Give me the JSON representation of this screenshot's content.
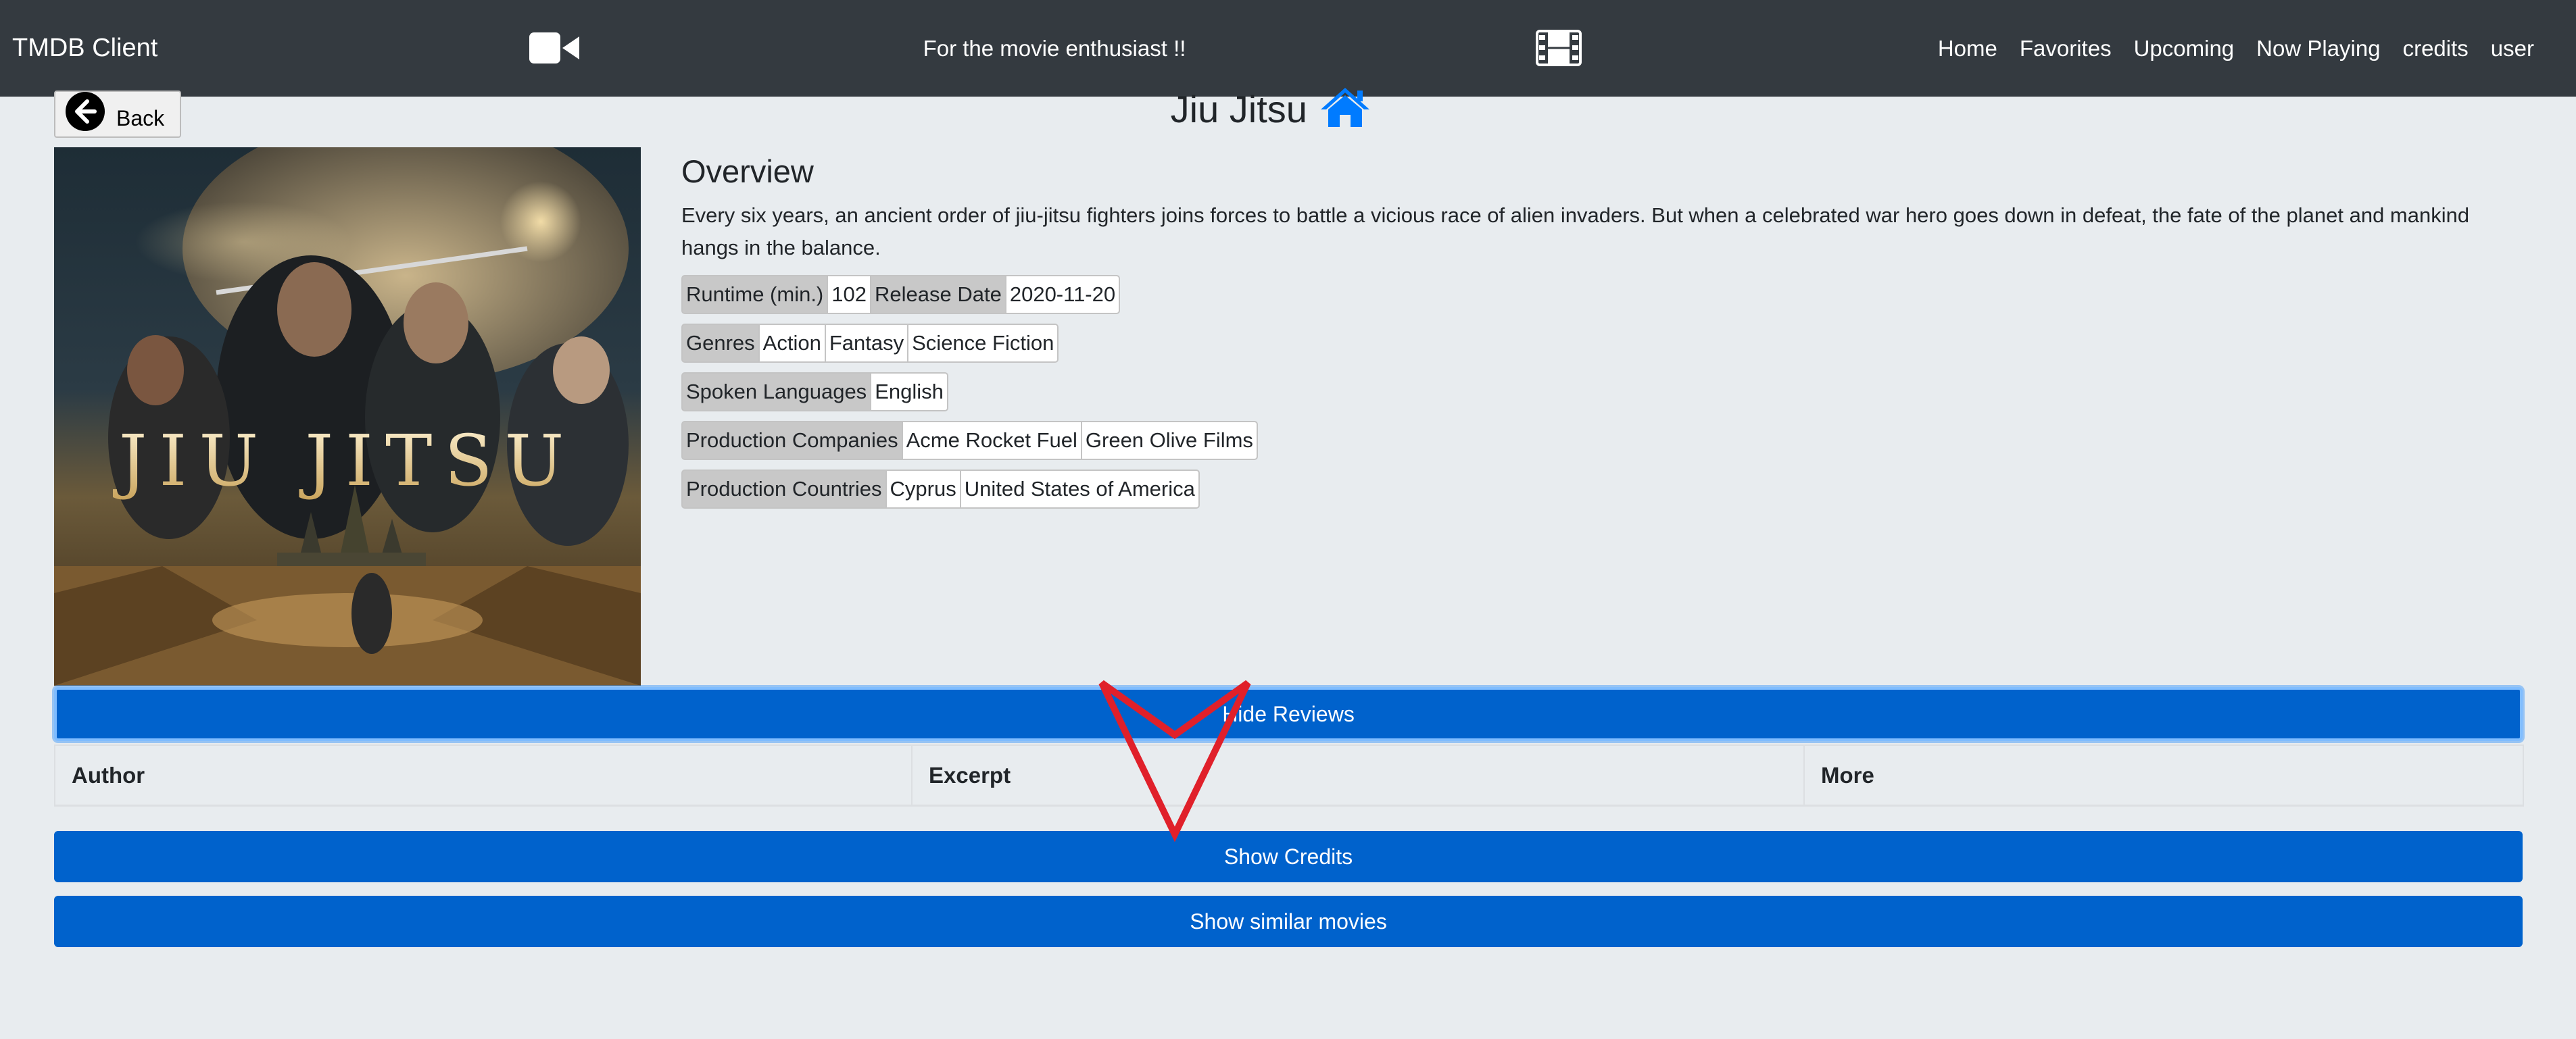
{
  "navbar": {
    "brand": "TMDB Client",
    "tagline": "For the movie enthusiast !!",
    "camera_icon": "video-camera-icon",
    "film_icon": "film-icon",
    "links": [
      "Home",
      "Favorites",
      "Upcoming",
      "Now Playing",
      "credits",
      "user"
    ]
  },
  "header": {
    "back_label": "Back",
    "back_icon": "arrow-left-circle-icon",
    "title": "Jiu Jitsu",
    "home_icon": "home-icon",
    "home_icon_color": "#007bff"
  },
  "poster": {
    "title_text": "JIU JITSU"
  },
  "overview": {
    "heading": "Overview",
    "text": "Every six years, an ancient order of jiu-jitsu fighters joins forces to battle a vicious race of alien invaders. But when a celebrated war hero goes down in defeat, the fate of the planet and mankind hangs in the balance.",
    "runtime_label": "Runtime (min.)",
    "runtime": "102",
    "release_label": "Release Date",
    "release_date": "2020-11-20",
    "genres_label": "Genres",
    "genres": [
      "Action",
      "Fantasy",
      "Science Fiction"
    ],
    "languages_label": "Spoken Languages",
    "languages": [
      "English"
    ],
    "companies_label": "Production Companies",
    "companies": [
      "Acme Rocket Fuel",
      "Green Olive Films"
    ],
    "countries_label": "Production Countries",
    "countries": [
      "Cyprus",
      "United States of America"
    ]
  },
  "reviews": {
    "toggle_label": "Hide Reviews",
    "columns": [
      "Author",
      "Excerpt",
      "More"
    ]
  },
  "buttons": {
    "credits_label": "Show Credits",
    "similar_label": "Show similar movies"
  },
  "colors": {
    "navbar_bg": "#343a40",
    "primary": "#0062cc",
    "page_bg": "#e8ecef",
    "annotation_red": "#e0202a"
  },
  "annotation": {
    "icon": "down-arrow-annotation-icon"
  }
}
